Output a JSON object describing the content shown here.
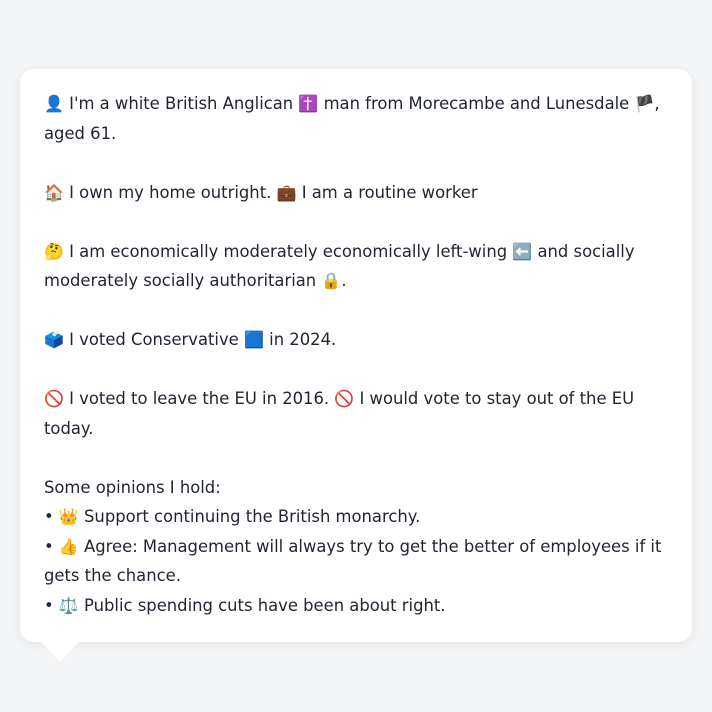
{
  "bio": {
    "line1_icon": "👤",
    "line1_a": "I'm a white British Anglican",
    "religion_icon": "✝️",
    "line1_b": "man from Morecambe and Lunesdale",
    "flag_icon": "🏴",
    "line1_c": ", aged 61."
  },
  "home": {
    "house_icon": "🏠",
    "own_text": "I own my home outright.",
    "work_icon": "💼",
    "work_text": "I am a routine worker"
  },
  "politics": {
    "think_icon": "🤔",
    "econ_text": "I am economically moderately economically left-wing",
    "left_icon": "⬅️",
    "social_text": "and socially moderately socially authoritarian",
    "lock_icon": "🔒",
    "end_punct": "."
  },
  "vote": {
    "ballot_icon": "🗳️",
    "vote_a": "I voted Conservative",
    "party_icon": "🟦",
    "vote_b": "in 2024."
  },
  "eu": {
    "no_icon_1": "🚫",
    "eu_a": "I voted to leave the EU in 2016.",
    "no_icon_2": "🚫",
    "eu_b": "I would vote to stay out of the EU today."
  },
  "opinions": {
    "heading": "Some opinions I hold:",
    "bullet": "•",
    "items": [
      {
        "icon": "👑",
        "text": "Support continuing the British monarchy."
      },
      {
        "icon": "👍",
        "text": "Agree: Management will always try to get the better of employees if it gets the chance."
      },
      {
        "icon": "⚖️",
        "text": "Public spending cuts have been about right."
      }
    ]
  },
  "colors": {
    "background": "#f3f4f6",
    "card": "#ffffff",
    "text": "#1f2430"
  }
}
